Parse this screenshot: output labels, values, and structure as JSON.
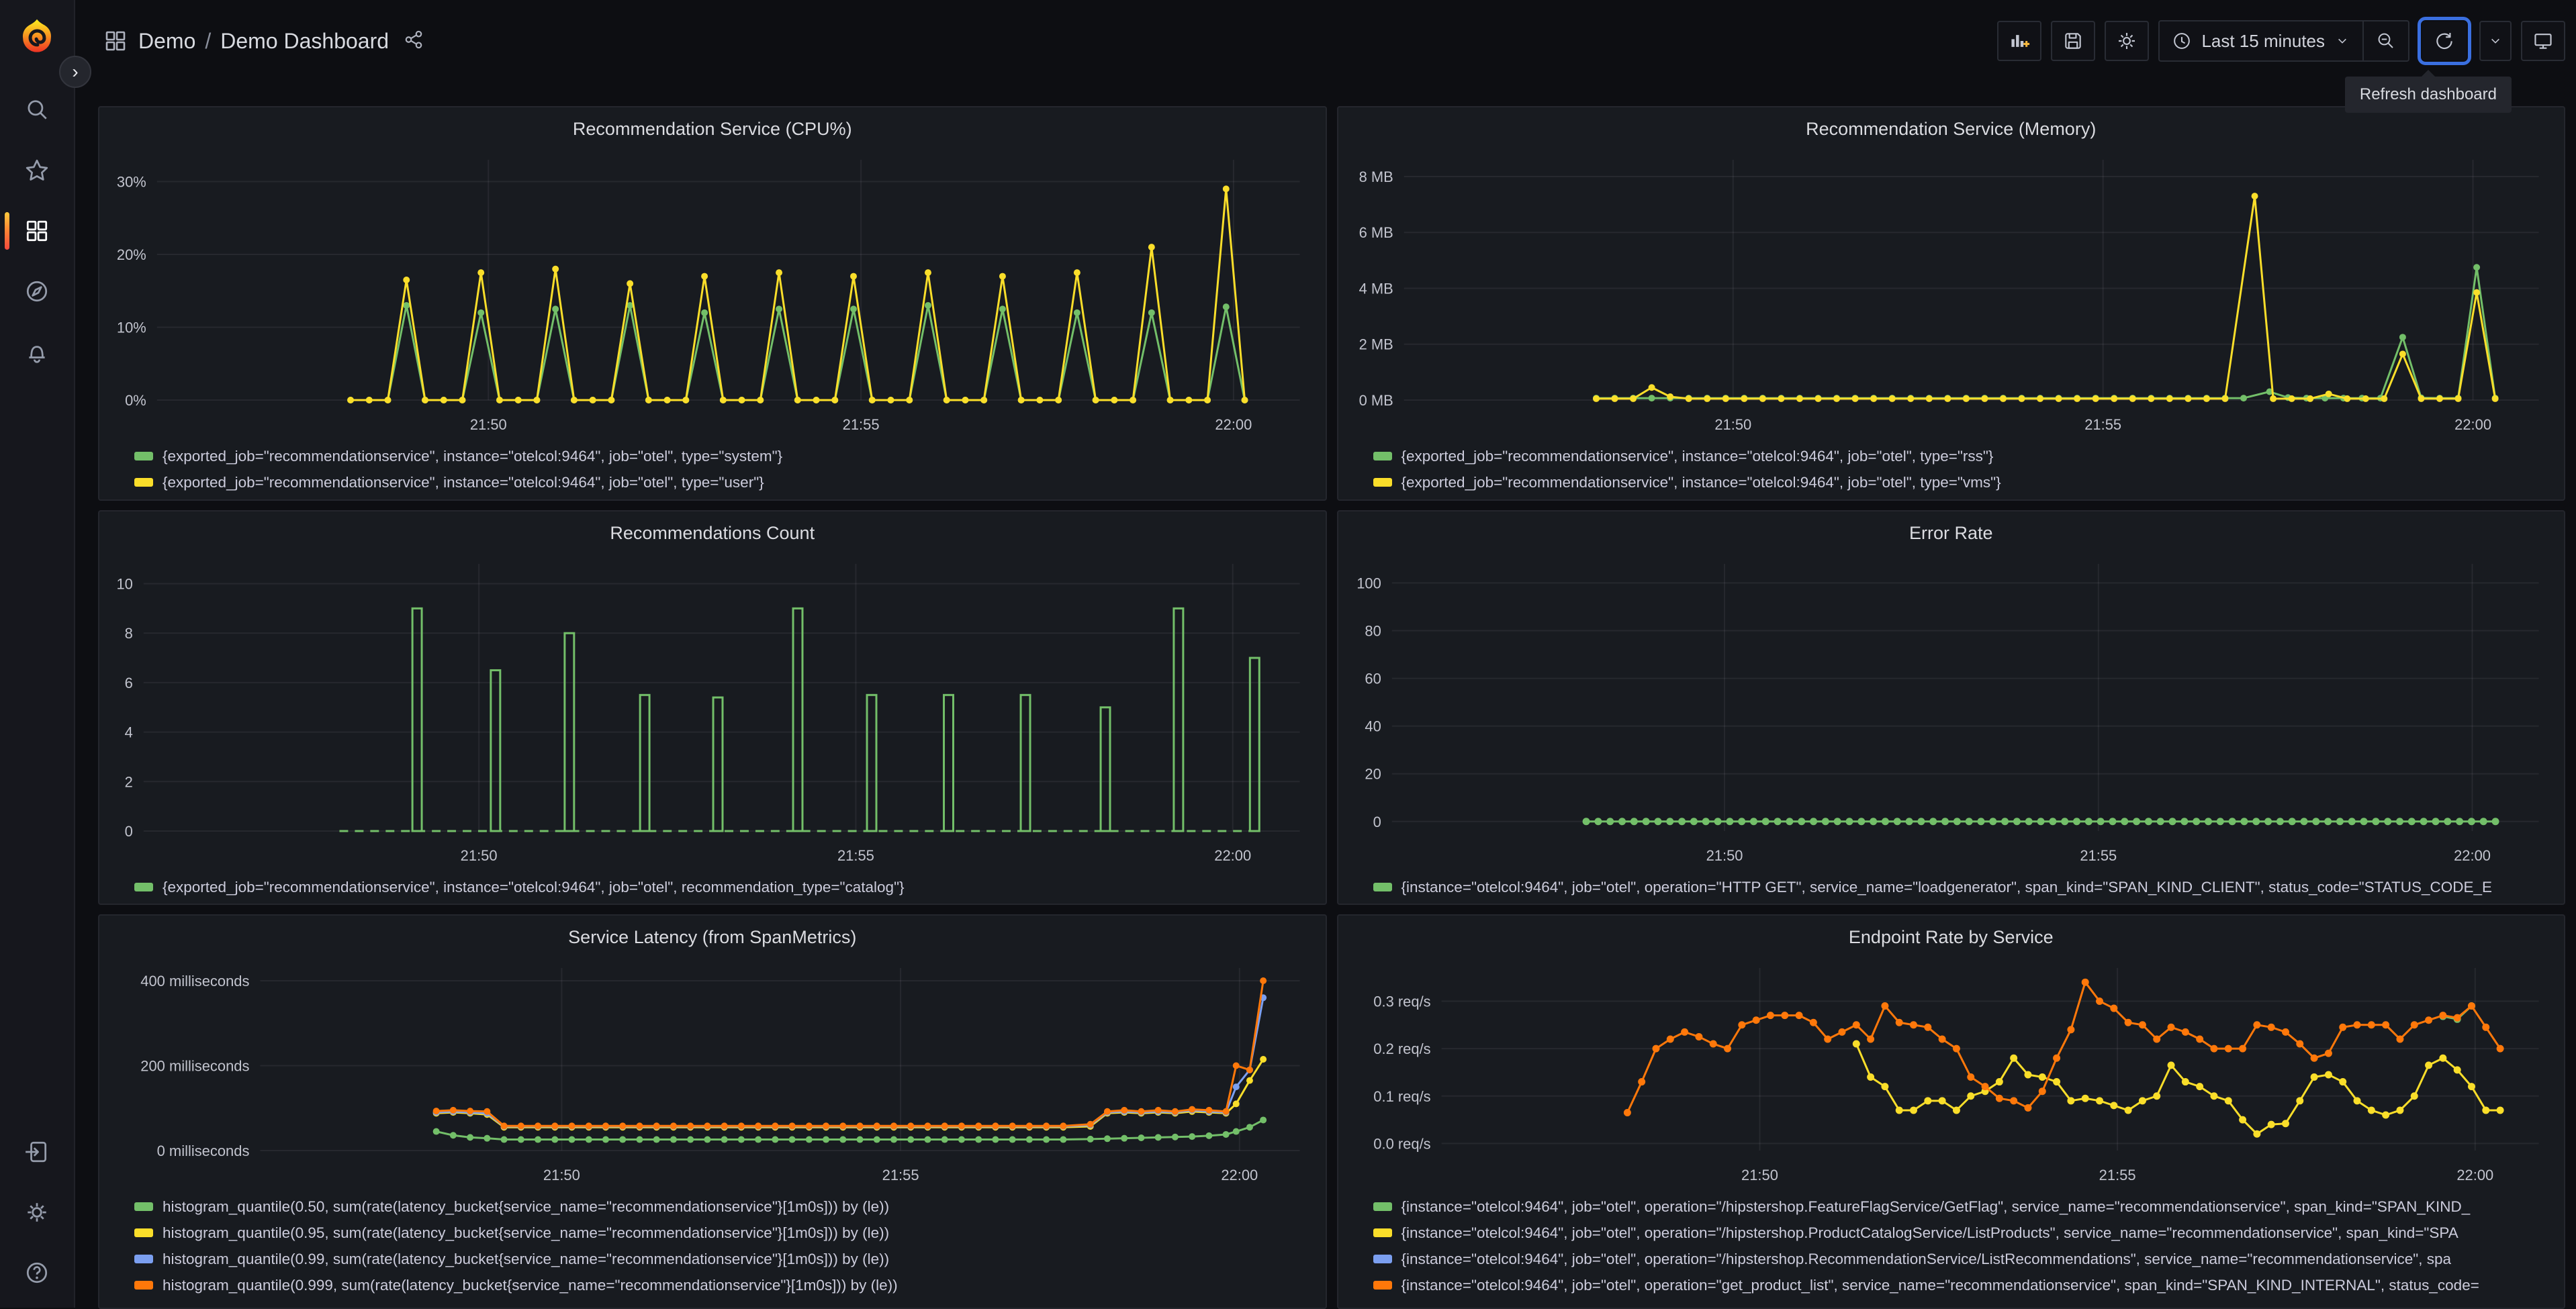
{
  "nav": {
    "breadcrumb": {
      "section": "Demo",
      "separator": "/",
      "page": "Demo Dashboard"
    },
    "time_picker": {
      "label": "Last 15 minutes"
    },
    "tooltip": "Refresh dashboard"
  },
  "colors": {
    "green": "#73BF69",
    "yellow": "#FADE2A",
    "blue": "#7B9FF0",
    "orange": "#FF780A",
    "accent_focus": "#3A6FE0",
    "panel_bg": "#181B20",
    "page_bg": "#0D0E12"
  },
  "chart_data": [
    {
      "type": "line",
      "title": "Recommendation Service (CPU%)",
      "ylim": [
        0,
        33
      ],
      "y_ticks": [
        {
          "v": 0,
          "label": "0%"
        },
        {
          "v": 10,
          "label": "10%"
        },
        {
          "v": 20,
          "label": "20%"
        },
        {
          "v": 30,
          "label": "30%"
        }
      ],
      "x_ticks": [
        {
          "t": 2.05,
          "label": "21:50"
        },
        {
          "t": 7.05,
          "label": "21:55"
        },
        {
          "t": 12.05,
          "label": "22:00"
        }
      ],
      "series": [
        {
          "name": "{exported_job=\"recommendationservice\", instance=\"otelcol:9464\", job=\"otel\", type=\"system\"}",
          "color": "#73BF69",
          "marker_r": 5,
          "pulse": {
            "start": 0.2,
            "end": 12.4,
            "step": 0.25,
            "base": 0,
            "times": [
              1,
              2,
              3,
              4,
              5,
              6,
              7,
              8,
              9,
              10,
              11,
              12
            ],
            "peaks": [
              13,
              12,
              12.5,
              13,
              12,
              12.5,
              12.5,
              13,
              12.5,
              12,
              12,
              12.8
            ]
          }
        },
        {
          "name": "{exported_job=\"recommendationservice\", instance=\"otelcol:9464\", job=\"otel\", type=\"user\"}",
          "color": "#FADE2A",
          "marker_r": 5,
          "pulse": {
            "start": 0.2,
            "end": 12.4,
            "step": 0.25,
            "base": 0,
            "times": [
              1,
              2,
              3,
              4,
              5,
              6,
              7,
              8,
              9,
              10,
              11,
              12
            ],
            "peaks": [
              16.5,
              17.5,
              18,
              16,
              17,
              17.5,
              17,
              17.5,
              17,
              17.5,
              21,
              29
            ]
          }
        }
      ]
    },
    {
      "type": "line",
      "title": "Recommendation Service (Memory)",
      "ylim": [
        0,
        8.6
      ],
      "y_ticks": [
        {
          "v": 0,
          "label": "0 MB"
        },
        {
          "v": 2,
          "label": "2 MB"
        },
        {
          "v": 4,
          "label": "4 MB"
        },
        {
          "v": 6,
          "label": "6 MB"
        },
        {
          "v": 8,
          "label": "8 MB"
        }
      ],
      "x_ticks": [
        {
          "t": 2.05,
          "label": "21:50"
        },
        {
          "t": 7.05,
          "label": "21:55"
        },
        {
          "t": 12.05,
          "label": "22:00"
        }
      ],
      "series": [
        {
          "name": "{exported_job=\"recommendationservice\", instance=\"otelcol:9464\", job=\"otel\", type=\"rss\"}",
          "color": "#73BF69",
          "marker_r": 5,
          "segments": [
            {
              "start": 0.2,
              "end": 9.05,
              "step": 0.25,
              "flat": 0.07
            },
            {
              "start": 9.3,
              "step": 0.25,
              "values": [
                0.3,
                0.09
              ]
            },
            {
              "start": 9.8,
              "end": 10.95,
              "step": 0.25,
              "flat": 0.07
            },
            {
              "start": 11.1,
              "step": 0.25,
              "values": [
                2.25,
                0.08
              ]
            },
            {
              "start": 11.6,
              "end": 11.85,
              "step": 0.25,
              "flat": 0.07
            },
            {
              "start": 12.1,
              "step": 0.25,
              "values": [
                4.75,
                0.07
              ]
            }
          ]
        },
        {
          "name": "{exported_job=\"recommendationservice\", instance=\"otelcol:9464\", job=\"otel\", type=\"vms\"}",
          "color": "#FADE2A",
          "marker_r": 5,
          "segments": [
            {
              "start": 0.2,
              "step": 0.25,
              "values": [
                0.05,
                0.05,
                0.05,
                0.45,
                0.12
              ]
            },
            {
              "start": 1.45,
              "end": 8.85,
              "step": 0.25,
              "flat": 0.05
            },
            {
              "start": 9.1,
              "step": 0.25,
              "values": [
                7.3,
                0.05
              ]
            },
            {
              "start": 9.6,
              "end": 9.85,
              "step": 0.25,
              "flat": 0.05
            },
            {
              "start": 10.1,
              "step": 0.25,
              "values": [
                0.22,
                0.05
              ]
            },
            {
              "start": 10.6,
              "end": 10.85,
              "step": 0.25,
              "flat": 0.05
            },
            {
              "start": 11.1,
              "step": 0.25,
              "values": [
                1.65,
                0.05
              ]
            },
            {
              "start": 11.6,
              "end": 11.85,
              "step": 0.25,
              "flat": 0.05
            },
            {
              "start": 12.1,
              "step": 0.25,
              "values": [
                3.85,
                0.05
              ]
            }
          ]
        }
      ]
    },
    {
      "type": "bar",
      "title": "Recommendations Count",
      "ylim": [
        0,
        10.8
      ],
      "y_ticks": [
        {
          "v": 0,
          "label": "0"
        },
        {
          "v": 2,
          "label": "2"
        },
        {
          "v": 4,
          "label": "4"
        },
        {
          "v": 6,
          "label": "6"
        },
        {
          "v": 8,
          "label": "8"
        },
        {
          "v": 10,
          "label": "10"
        }
      ],
      "x_ticks": [
        {
          "t": 2.05,
          "label": "21:50"
        },
        {
          "t": 7.05,
          "label": "21:55"
        },
        {
          "t": 12.05,
          "label": "22:00"
        }
      ],
      "series": [
        {
          "name": "{exported_job=\"recommendationservice\", instance=\"otelcol:9464\", job=\"otel\", recommendation_type=\"catalog\"}",
          "color": "#73BF69",
          "marker_r": 0,
          "bars": {
            "t": [
              1.23,
              2.27,
              3.25,
              4.25,
              5.22,
              6.28,
              7.26,
              8.28,
              9.3,
              10.36,
              11.33,
              12.34
            ],
            "values": [
              9,
              6.5,
              8,
              5.5,
              5.4,
              9,
              5.5,
              5.5,
              5.5,
              5,
              9,
              7
            ],
            "width": 14
          },
          "baseline": {
            "start": 0.2,
            "end": 12.45,
            "value": 0,
            "dashed": true
          }
        }
      ]
    },
    {
      "type": "line",
      "title": "Error Rate",
      "ylim": [
        -4,
        108
      ],
      "y_ticks": [
        {
          "v": 0,
          "label": "0"
        },
        {
          "v": 20,
          "label": "20"
        },
        {
          "v": 40,
          "label": "40"
        },
        {
          "v": 60,
          "label": "60"
        },
        {
          "v": 80,
          "label": "80"
        },
        {
          "v": 100,
          "label": "100"
        }
      ],
      "x_ticks": [
        {
          "t": 2.05,
          "label": "21:50"
        },
        {
          "t": 7.05,
          "label": "21:55"
        },
        {
          "t": 12.05,
          "label": "22:00"
        }
      ],
      "series": [
        {
          "name": "{instance=\"otelcol:9464\", job=\"otel\", operation=\"HTTP GET\", service_name=\"loadgenerator\", span_kind=\"SPAN_KIND_CLIENT\", status_code=\"STATUS_CODE_E",
          "color": "#73BF69",
          "marker_r": 5.5,
          "segments": [
            {
              "start": 0.2,
              "end": 12.4,
              "step": 0.16,
              "flat": 0
            }
          ]
        }
      ]
    },
    {
      "type": "line",
      "title": "Service Latency (from SpanMetrics)",
      "ylim": [
        0,
        430
      ],
      "y_ticks": [
        {
          "v": 0,
          "label": "0 milliseconds"
        },
        {
          "v": 200,
          "label": "200 milliseconds"
        },
        {
          "v": 400,
          "label": "400 milliseconds"
        }
      ],
      "x_ticks": [
        {
          "t": 2.05,
          "label": "21:50"
        },
        {
          "t": 7.05,
          "label": "21:55"
        },
        {
          "t": 12.05,
          "label": "22:00"
        }
      ],
      "series": [
        {
          "name": "histogram_quantile(0.50, sum(rate(latency_bucket{service_name=\"recommendationservice\"}[1m0s])) by (le))",
          "color": "#73BF69",
          "marker_r": 5,
          "segments": [
            {
              "start": 0.2,
              "step": 0.25,
              "values": [
                45,
                36,
                31,
                29
              ]
            },
            {
              "start": 1.2,
              "end": 9.6,
              "step": 0.25,
              "flat": 26
            },
            {
              "start": 9.85,
              "step": 0.25,
              "values": [
                27,
                28,
                29,
                30,
                31,
                32,
                33,
                35,
                38
              ]
            },
            {
              "start": 12.0,
              "step": 0.2,
              "values": [
                45,
                55,
                72
              ]
            }
          ]
        },
        {
          "name": "histogram_quantile(0.95, sum(rate(latency_bucket{service_name=\"recommendationservice\"}[1m0s])) by (le))",
          "color": "#FADE2A",
          "marker_r": 5,
          "segments": [
            {
              "start": 0.2,
              "step": 0.25,
              "values": [
                88,
                90,
                88,
                85
              ]
            },
            {
              "start": 1.2,
              "end": 9.6,
              "step": 0.25,
              "flat": 55
            },
            {
              "start": 9.85,
              "step": 0.25,
              "values": [
                57,
                88,
                90,
                88,
                90,
                88,
                92,
                90,
                88
              ]
            },
            {
              "start": 12.0,
              "step": 0.2,
              "values": [
                110,
                165,
                215
              ]
            }
          ]
        },
        {
          "name": "histogram_quantile(0.99, sum(rate(latency_bucket{service_name=\"recommendationservice\"}[1m0s])) by (le))",
          "color": "#7B9FF0",
          "marker_r": 5,
          "segments": [
            {
              "start": 0.2,
              "step": 0.25,
              "values": [
                90,
                92,
                90,
                88
              ]
            },
            {
              "start": 1.2,
              "end": 9.6,
              "step": 0.25,
              "flat": 57
            },
            {
              "start": 9.85,
              "step": 0.25,
              "values": [
                60,
                90,
                92,
                90,
                92,
                90,
                95,
                92,
                90
              ]
            },
            {
              "start": 12.0,
              "step": 0.2,
              "values": [
                150,
                190,
                360
              ]
            }
          ]
        },
        {
          "name": "histogram_quantile(0.999, sum(rate(latency_bucket{service_name=\"recommendationservice\"}[1m0s])) by (le))",
          "color": "#FF780A",
          "marker_r": 5,
          "segments": [
            {
              "start": 0.2,
              "step": 0.25,
              "values": [
                93,
                95,
                93,
                92
              ]
            },
            {
              "start": 1.2,
              "end": 9.6,
              "step": 0.25,
              "flat": 58
            },
            {
              "start": 9.85,
              "step": 0.25,
              "values": [
                62,
                92,
                95,
                92,
                95,
                92,
                97,
                95,
                92
              ]
            },
            {
              "start": 12.0,
              "step": 0.2,
              "values": [
                200,
                190,
                400
              ]
            }
          ]
        }
      ]
    },
    {
      "type": "line",
      "title": "Endpoint Rate by Service",
      "ylim": [
        -0.015,
        0.37
      ],
      "y_ticks": [
        {
          "v": 0,
          "label": "0.0 req/s"
        },
        {
          "v": 0.1,
          "label": "0.1 req/s"
        },
        {
          "v": 0.2,
          "label": "0.2 req/s"
        },
        {
          "v": 0.3,
          "label": "0.3 req/s"
        }
      ],
      "x_ticks": [
        {
          "t": 2.05,
          "label": "21:50"
        },
        {
          "t": 7.05,
          "label": "21:55"
        },
        {
          "t": 12.05,
          "label": "22:00"
        }
      ],
      "series": [
        {
          "name": "{instance=\"otelcol:9464\", job=\"otel\", operation=\"/hipstershop.FeatureFlagService/GetFlag\", service_name=\"recommendationservice\", span_kind=\"SPAN_KIND_",
          "color": "#73BF69",
          "marker_r": 5.5,
          "points": [
            [
              11.6,
              0.268
            ],
            [
              11.8,
              0.262
            ],
            [
              12.0,
              0.29
            ]
          ]
        },
        {
          "name": "{instance=\"otelcol:9464\", job=\"otel\", operation=\"/hipstershop.ProductCatalogService/ListProducts\", service_name=\"recommendationservice\", span_kind=\"SPA",
          "color": "#FADE2A",
          "marker_r": 5.5,
          "start": 3.4,
          "step": 0.2,
          "values": [
            0.21,
            0.14,
            0.12,
            0.07,
            0.07,
            0.09,
            0.09,
            0.07,
            0.1,
            0.11,
            0.13,
            0.18,
            0.145,
            0.14,
            0.13,
            0.09,
            0.095,
            0.09,
            0.08,
            0.07,
            0.09,
            0.1,
            0.165,
            0.13,
            0.12,
            0.1,
            0.09,
            0.05,
            0.02,
            0.04,
            0.042,
            0.09,
            0.14,
            0.145,
            0.13,
            0.09,
            0.07,
            0.06,
            0.07,
            0.1,
            0.165,
            0.18,
            0.155,
            0.12,
            0.07,
            0.07
          ]
        },
        {
          "name": "{instance=\"otelcol:9464\", job=\"otel\", operation=\"/hipstershop.RecommendationService/ListRecommendations\", service_name=\"recommendationservice\", spa",
          "color": "#7B9FF0",
          "marker_r": 5.5,
          "points": []
        },
        {
          "name": "{instance=\"otelcol:9464\", job=\"otel\", operation=\"get_product_list\", service_name=\"recommendationservice\", span_kind=\"SPAN_KIND_INTERNAL\", status_code=",
          "color": "#FF780A",
          "marker_r": 5.5,
          "start": 0.2,
          "step": 0.2,
          "values": [
            0.065,
            0.13,
            0.2,
            0.22,
            0.235,
            0.225,
            0.21,
            0.2,
            0.25,
            0.26,
            0.27,
            0.27,
            0.27,
            0.255,
            0.22,
            0.235,
            0.25,
            0.22,
            0.29,
            0.255,
            0.25,
            0.245,
            0.22,
            0.2,
            0.14,
            0.12,
            0.095,
            0.09,
            0.075,
            0.11,
            0.18,
            0.24,
            0.34,
            0.3,
            0.285,
            0.255,
            0.25,
            0.22,
            0.245,
            0.235,
            0.22,
            0.2,
            0.2,
            0.2,
            0.25,
            0.245,
            0.235,
            0.21,
            0.18,
            0.19,
            0.245,
            0.25,
            0.25,
            0.25,
            0.22,
            0.25,
            0.26,
            0.27,
            0.265,
            0.29,
            0.245,
            0.2
          ]
        }
      ]
    }
  ]
}
